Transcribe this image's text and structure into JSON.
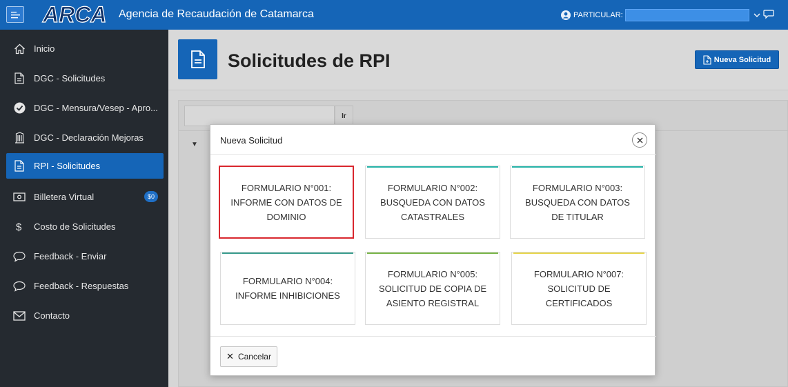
{
  "header": {
    "app_title": "Agencia de Recaudación de Catamarca",
    "logo_text": "ARCA",
    "user_label": "PARTICULAR:"
  },
  "sidebar": {
    "items": [
      {
        "label": "Inicio",
        "icon": "home-icon"
      },
      {
        "label": "DGC - Solicitudes",
        "icon": "document-icon"
      },
      {
        "label": "DGC - Mensura/Vesep - Apro...",
        "icon": "check-circle-icon"
      },
      {
        "label": "DGC - Declaración Mejoras",
        "icon": "building-icon"
      },
      {
        "label": "RPI - Solicitudes",
        "icon": "document-icon",
        "active": true
      },
      {
        "label": "Billetera Virtual",
        "icon": "money-icon",
        "badge": "$0"
      },
      {
        "label": "Costo de Solicitudes",
        "icon": "dollar-icon"
      },
      {
        "label": "Feedback - Enviar",
        "icon": "chat-icon"
      },
      {
        "label": "Feedback - Respuestas",
        "icon": "chat-icon"
      },
      {
        "label": "Contacto",
        "icon": "mail-icon"
      }
    ]
  },
  "page": {
    "title": "Solicitudes de RPI",
    "new_button": "Nueva Solicitud",
    "go_button": "Ir"
  },
  "modal": {
    "title": "Nueva Solicitud",
    "cancel_label": "Cancelar",
    "cards": [
      {
        "label": "FORMULARIO N°001: INFORME CON DATOS DE DOMINIO",
        "accent": "#d9272e",
        "selected": true
      },
      {
        "label": "FORMULARIO N°002: BUSQUEDA CON DATOS CATASTRALES",
        "accent": "#26b3a8"
      },
      {
        "label": "FORMULARIO N°003: BUSQUEDA CON DATOS DE TITULAR",
        "accent": "#26b3a8"
      },
      {
        "label": "FORMULARIO N°004: INFORME INHIBICIONES",
        "accent": "#3a9e8f"
      },
      {
        "label": "FORMULARIO N°005: SOLICITUD DE COPIA DE ASIENTO REGISTRAL",
        "accent": "#7ab648"
      },
      {
        "label": "FORMULARIO N°007: SOLICITUD DE CERTIFICADOS",
        "accent": "#e8d64b"
      }
    ]
  },
  "colors": {
    "primary": "#1565b7",
    "sidebar_bg": "#252a30",
    "selected_border": "#d9272e"
  }
}
